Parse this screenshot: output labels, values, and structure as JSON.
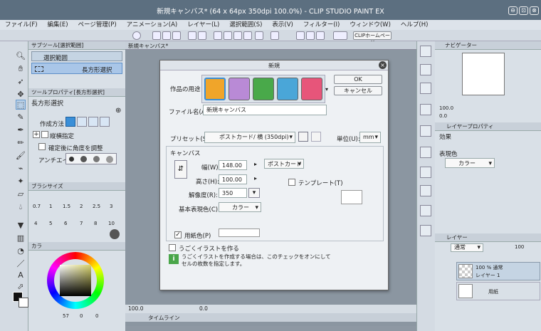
{
  "app": {
    "title": "新規キャンバス* (64 x 64px 350dpi 100.0%) - CLIP STUDIO PAINT EX",
    "win_min": "⊖",
    "win_max": "⊡",
    "win_close": "⊗"
  },
  "menu": [
    "ファイル(F)",
    "編集(E)",
    "ページ管理(P)",
    "アニメーション(A)",
    "レイヤー(L)",
    "選択範囲(S)",
    "表示(V)",
    "フィルター(I)",
    "ウィンドウ(W)",
    "ヘルプ(H)"
  ],
  "cmdbar": {
    "home_label": "CLIPホームページ"
  },
  "subtool": {
    "tab": "サブツール[選択範囲]",
    "group": "選択範囲",
    "item": "長方形選択"
  },
  "toolprop": {
    "tab": "ツールプロパティ[長方形選択]",
    "heading": "長方形選択",
    "method": "作成方法",
    "aspect": "縦横指定",
    "adjust": "確定後に角度を調整",
    "antialias": "アンチエイリ"
  },
  "brushsize": {
    "tab": "ブラシサイズ",
    "values": [
      "0.7",
      "1",
      "1.5",
      "2",
      "2.5",
      "3",
      "4",
      "5",
      "6",
      "7",
      "8",
      "10"
    ]
  },
  "color": {
    "tab": "カラ",
    "h": "57",
    "s": "0",
    "v": "0",
    "accent": "#d7d26b"
  },
  "canvas": {
    "tab": "新規キャンバス*",
    "status_zoom": "100.0",
    "status_angle": "0.0",
    "timeline": "タイムライン"
  },
  "dialog": {
    "title": "新規",
    "usage_label": "作品の用途",
    "ok": "OK",
    "cancel": "キャンセル",
    "filename_label": "ファイル名(A):",
    "filename_value": "新規キャンバス",
    "preset_label": "プリセット(S):",
    "preset_value": "ポストカード/ 横 (350dpi)",
    "unit_label": "単位(U):",
    "unit_value": "mm",
    "canvas_section": "キャンバス",
    "width_label": "幅(W):",
    "width_value": "148.00",
    "height_label": "高さ(H):",
    "height_value": "100.00",
    "size_preset": "ポストカード",
    "template": "テンプレート(T)",
    "resolution_label": "解像度(R):",
    "resolution_value": "350",
    "color_mode_label": "基本表現色(C):",
    "color_mode_value": "カラー",
    "paper_label": "用紙色(P)",
    "anim_label": "うごくイラストを作る",
    "anim_hint_1": "うごくイラストを作成する場合は、このチェックをオンにして",
    "anim_hint_2": "セルの枚数を指定します。"
  },
  "navigator": {
    "tab": "ナビゲーター",
    "zoom": "100.0",
    "angle": "0.0"
  },
  "layerprop": {
    "tab": "レイヤープロパティ",
    "effect": "効果",
    "expression": "表現色",
    "expression_value": "カラー"
  },
  "layers": {
    "tab": "レイヤー",
    "blend": "通常",
    "opacity": "100",
    "items": [
      {
        "name": "100 % 通常",
        "sub": "レイヤー 1"
      },
      {
        "name": "用紙",
        "sub": ""
      }
    ]
  }
}
